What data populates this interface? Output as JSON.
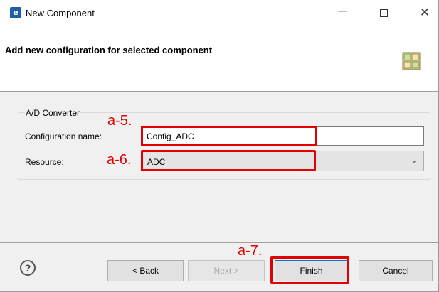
{
  "window": {
    "title": "New Component",
    "app_icon": "renesas-app-icon",
    "controls": {
      "minimize": "—",
      "maximize": "",
      "close": "✕"
    }
  },
  "header": {
    "title": "Add new configuration for selected component",
    "icon": "component-grid-icon"
  },
  "group": {
    "label": "A/D Converter",
    "configuration_name_label": "Configuration name:",
    "configuration_name_value": "Config_ADC",
    "resource_label": "Resource:",
    "resource_value": "ADC"
  },
  "footer": {
    "help": "?",
    "back": "< Back",
    "next": "Next >",
    "finish": "Finish",
    "cancel": "Cancel"
  },
  "annotations": {
    "a5": "a-5.",
    "a6": "a-6.",
    "a7": "a-7.",
    "color": "#e20000"
  }
}
